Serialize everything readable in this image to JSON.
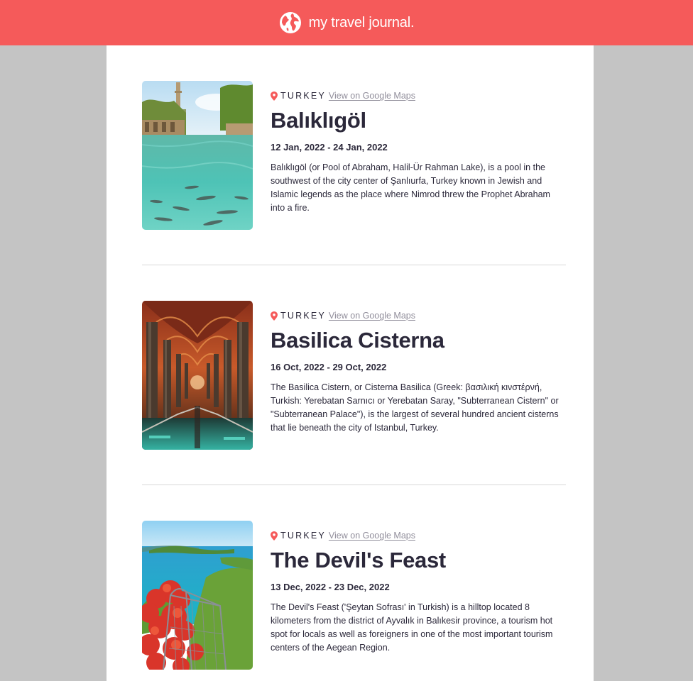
{
  "header": {
    "title": "my travel journal.",
    "icon": "globe-icon"
  },
  "accent": "#f55a5a",
  "entries": [
    {
      "country": "TURKEY",
      "map_link": "View on Google Maps",
      "place": "Balıklıgöl",
      "dates": "12 Jan, 2022 - 24 Jan, 2022",
      "description": "Balıklıgöl (or Pool of Abraham, Halil-Ür Rahman Lake), is a pool in the southwest of the city center of Şanlıurfa, Turkey known in Jewish and Islamic legends as the place where Nimrod threw the Prophet Abraham into a fire."
    },
    {
      "country": "TURKEY",
      "map_link": "View on Google Maps",
      "place": "Basilica Cisterna",
      "dates": "16 Oct, 2022 - 29 Oct, 2022",
      "description": "The Basilica Cistern, or Cisterna Basilica (Greek: βασιλική κινστέρνή, Turkish: Yerebatan Sarnıcı or Yerebatan Saray, \"Subterranean Cistern\" or \"Subterranean Palace\"), is the largest of several hundred ancient cisterns that lie beneath the city of Istanbul, Turkey."
    },
    {
      "country": "TURKEY",
      "map_link": "View on Google Maps",
      "place": "The Devil's Feast",
      "dates": "13 Dec, 2022 - 23 Dec, 2022",
      "description": "The Devil's Feast ('Şeytan Sofrası' in Turkish) is a hilltop located 8 kilometers from the district of Ayvalık in Balıkesir province, a tourism hot spot for locals as well as foreigners in one of the most important tourism centers of the Aegean Region."
    }
  ]
}
